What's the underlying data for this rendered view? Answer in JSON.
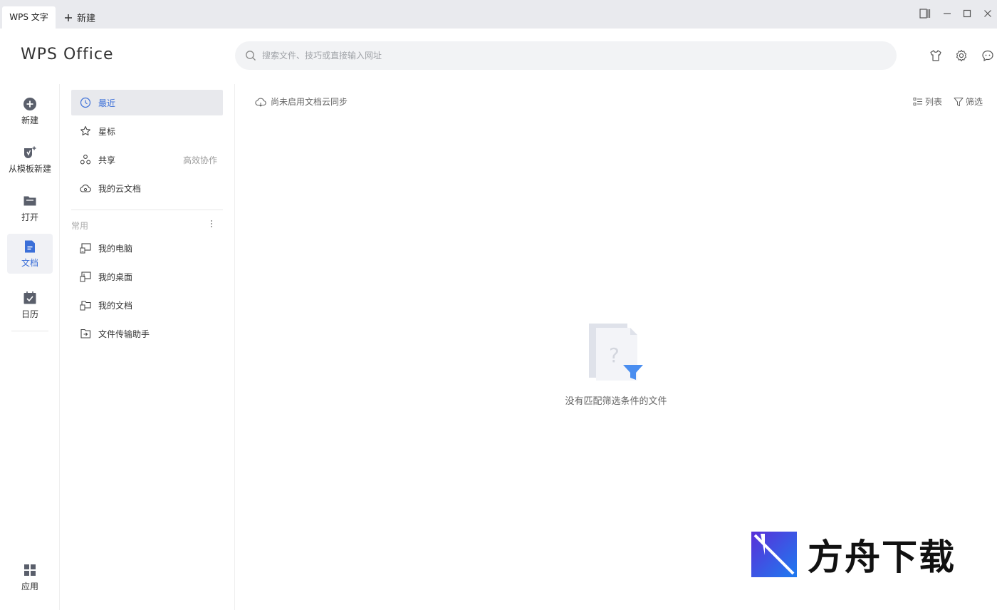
{
  "titlebar": {
    "active_tab": "WPS 文字",
    "new_tab_label": "新建"
  },
  "header": {
    "logo": "WPS Office",
    "search_placeholder": "搜索文件、技巧或直接输入网址"
  },
  "leftnav": {
    "items": [
      {
        "label": "新建",
        "icon": "plus-circle-icon"
      },
      {
        "label": "从模板新建",
        "icon": "template-icon"
      },
      {
        "label": "打开",
        "icon": "folder-icon"
      },
      {
        "label": "文档",
        "icon": "document-icon"
      },
      {
        "label": "日历",
        "icon": "calendar-icon"
      }
    ],
    "apps_label": "应用"
  },
  "sidepanel": {
    "items": [
      {
        "label": "最近",
        "icon": "clock-icon"
      },
      {
        "label": "星标",
        "icon": "star-icon"
      },
      {
        "label": "共享",
        "icon": "share-icon",
        "extra": "高效协作"
      },
      {
        "label": "我的云文档",
        "icon": "cloud-icon"
      }
    ],
    "group_label": "常用",
    "common_items": [
      {
        "label": "我的电脑",
        "icon": "computer-icon"
      },
      {
        "label": "我的桌面",
        "icon": "desktop-icon"
      },
      {
        "label": "我的文档",
        "icon": "my-documents-icon"
      },
      {
        "label": "文件传输助手",
        "icon": "file-transfer-icon"
      }
    ]
  },
  "main": {
    "sync_status": "尚未启用文档云同步",
    "list_label": "列表",
    "filter_label": "筛选",
    "empty_message": "没有匹配筛选条件的文件"
  },
  "watermark": {
    "text": "方舟下载"
  },
  "colors": {
    "accent": "#3b6fd8",
    "titlebar_bg": "#e9eaee",
    "active_bg": "#e8e9ed"
  }
}
